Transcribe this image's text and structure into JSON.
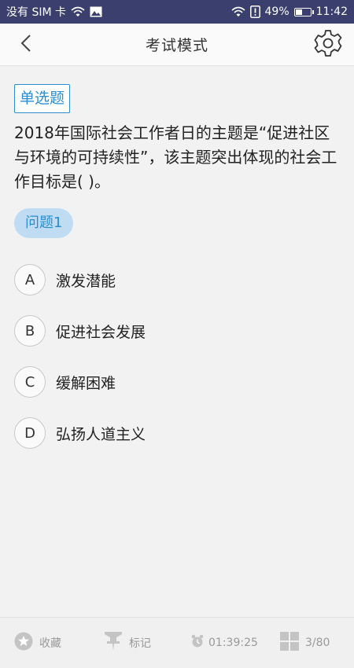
{
  "status_bar": {
    "carrier": "没有 SIM 卡",
    "battery": "49%",
    "battery_level": 0.49,
    "time": "11:42",
    "icons": [
      "wifi-icon",
      "image-icon",
      "alert-icon",
      "battery-icon"
    ]
  },
  "header": {
    "title": "考试模式",
    "back_icon": "chevron-left-icon",
    "settings_icon": "gear-icon"
  },
  "question": {
    "type": "单选题",
    "text": "2018年国际社会工作者日的主题是“促进社区与环境的可持续性”，该主题突出体现的社会工作目标是( )。",
    "number_label": "问题1",
    "options": [
      {
        "letter": "A",
        "text": "激发潜能"
      },
      {
        "letter": "B",
        "text": "促进社会发展"
      },
      {
        "letter": "C",
        "text": "缓解困难"
      },
      {
        "letter": "D",
        "text": "弘扬人道主义"
      }
    ]
  },
  "bottom_bar": {
    "favorite_label": "收藏",
    "mark_label": "标记",
    "timer": "01:39:25",
    "progress": "3/80",
    "icons": [
      "star-icon",
      "pin-icon",
      "alarm-clock-icon",
      "grid-icon"
    ]
  },
  "colors": {
    "status_bar_bg": "#3a3f6d",
    "accent": "#2a8ed0",
    "chip_bg": "#bfdcf3",
    "muted": "#999999"
  }
}
